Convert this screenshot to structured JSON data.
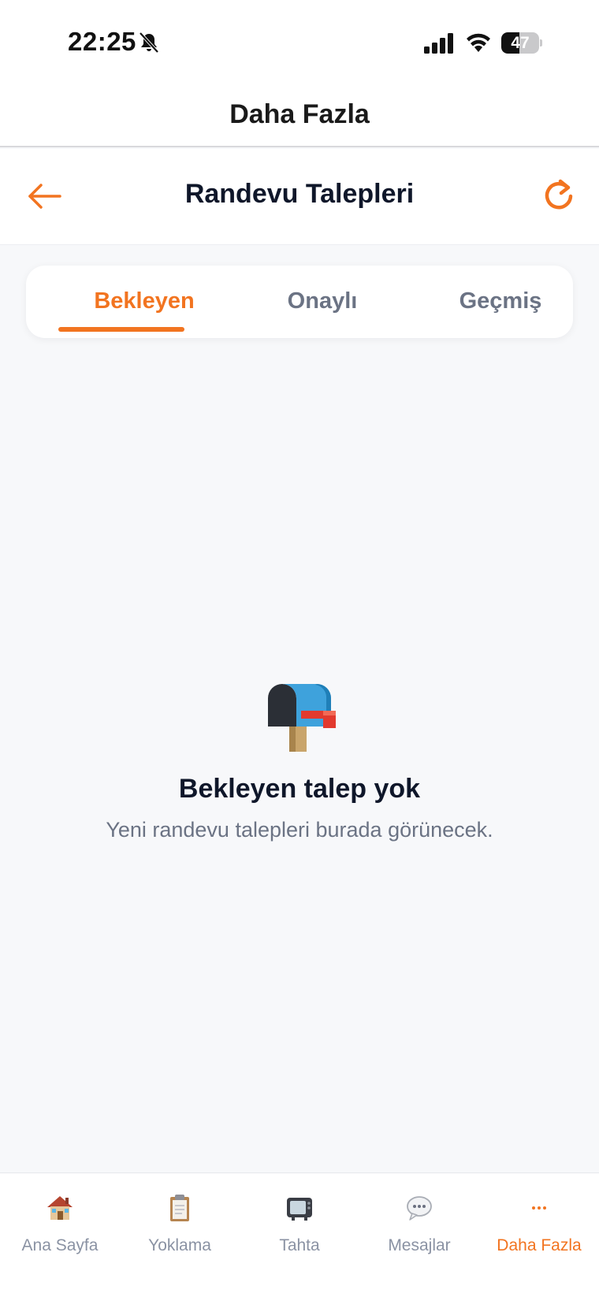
{
  "status_bar": {
    "time": "22:25",
    "battery_level": "47",
    "battery_fraction": 0.47,
    "icons": [
      "bell-off-icon",
      "signal-icon",
      "wifi-icon",
      "battery-icon"
    ]
  },
  "nav": {
    "title": "Daha Fazla"
  },
  "header": {
    "title": "Randevu Talepleri",
    "back_icon": "arrow-left-icon",
    "refresh_icon": "refresh-icon"
  },
  "tabs": [
    {
      "label": "Bekleyen",
      "active": true
    },
    {
      "label": "Onaylı",
      "active": false
    },
    {
      "label": "Geçmiş",
      "active": false
    }
  ],
  "empty_state": {
    "icon": "mailbox-icon",
    "title": "Bekleyen talep yok",
    "subtitle": "Yeni randevu talepleri burada görünecek."
  },
  "bottom_nav": [
    {
      "label": "Ana Sayfa",
      "icon": "house-icon",
      "active": false
    },
    {
      "label": "Yoklama",
      "icon": "clipboard-icon",
      "active": false
    },
    {
      "label": "Tahta",
      "icon": "television-icon",
      "active": false
    },
    {
      "label": "Mesajlar",
      "icon": "speech-bubble-icon",
      "active": false
    },
    {
      "label": "Daha Fazla",
      "icon": "ellipsis-icon",
      "active": true
    }
  ],
  "colors": {
    "accent": "#f27420",
    "text_primary": "#0f172a",
    "text_secondary": "#6b7384",
    "background": "#f7f8fa"
  }
}
